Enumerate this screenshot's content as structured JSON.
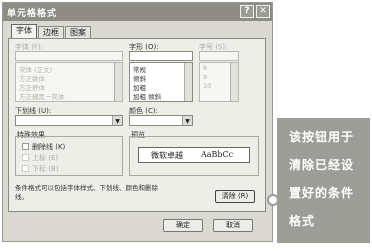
{
  "dialog": {
    "title": "单元格格式",
    "help_label": "?",
    "close_label": "✕"
  },
  "tabs": [
    {
      "label": "字体",
      "active": true
    },
    {
      "label": "边框",
      "active": false
    },
    {
      "label": "图案",
      "active": false
    }
  ],
  "font_section": {
    "font_label": "字体 (F):",
    "font_items": [
      "宋体 (正文)",
      "方正姚体",
      "方正舒体",
      "方正细黑一简体"
    ],
    "style_label": "字形 (O):",
    "style_items": [
      "常规",
      "倾斜",
      "加粗",
      "加粗 倾斜"
    ],
    "size_label": "字号 (S):",
    "size_items": [
      "8",
      "9",
      "10"
    ],
    "underline_label": "下划线 (U):",
    "color_label": "颜色 (C):"
  },
  "effects": {
    "group_label": "特殊效果",
    "strike_label": "删除线 (K)",
    "super_label": "上标 (E)",
    "sub_label": "下标 (B)"
  },
  "preview": {
    "group_label": "预览",
    "sample_cn": "微软卓越",
    "sample_en": "AaBbCc"
  },
  "info_text_line1": "条件格式可以包括字体样式、下划线、颜色和删除",
  "info_text_line2": "线。",
  "buttons": {
    "clear": "清除 (R)",
    "ok": "确定",
    "cancel": "取消"
  },
  "callout": {
    "lines": [
      "该按钮用于",
      "清除已经设",
      "置好的条件",
      "格式"
    ]
  }
}
